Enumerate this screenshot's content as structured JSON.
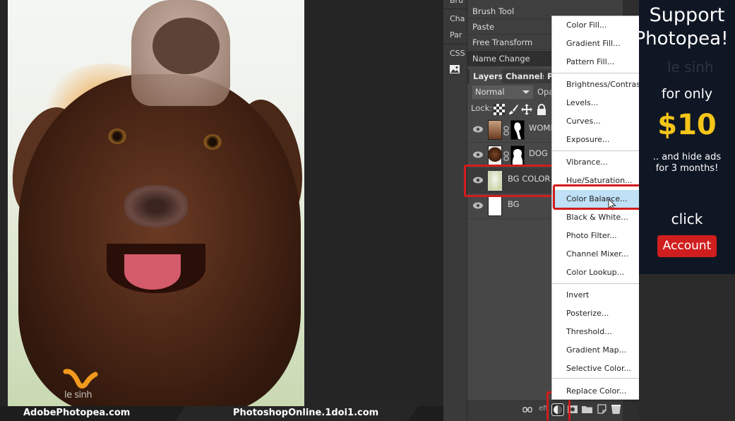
{
  "canvas": {
    "watermark": "le sinh",
    "banner_left": "AdobePhotopea.com",
    "banner_right": "PhotoshopOnline.1doi1.com"
  },
  "side_strip": {
    "items": [
      {
        "label": "Bru",
        "icon": "brush-panel"
      },
      {
        "label": "Cha",
        "icon": "character-panel"
      },
      {
        "label": "Par",
        "icon": "paragraph-panel"
      },
      {
        "label": "CSS",
        "icon": "css-panel"
      },
      {
        "label": "",
        "icon": "image-icon"
      }
    ]
  },
  "history": {
    "items": [
      "Brush Tool",
      "Paste",
      "Free Transform",
      "Name Change"
    ],
    "selected_index": 3
  },
  "layers_panel": {
    "tabs": [
      "Layers",
      "Channels",
      "P"
    ],
    "active_tab": "Layers",
    "blend_mode": "Normal",
    "opacity_label": "Opa",
    "lock_label": "Lock:",
    "layers": [
      {
        "name": "WOME",
        "visible": true,
        "has_mask": true
      },
      {
        "name": "DOG",
        "visible": true,
        "has_mask": true
      },
      {
        "name": "BG COLOR",
        "visible": true,
        "has_mask": false,
        "selected": true
      },
      {
        "name": "BG",
        "visible": true,
        "has_mask": false
      }
    ],
    "footer_icons": [
      "link-icon",
      "effects-icon",
      "adjustment-layer-icon",
      "mask-icon",
      "folder-icon",
      "new-layer-icon",
      "trash-icon"
    ],
    "effects_label": "eff"
  },
  "adjustment_menu": {
    "groups": [
      [
        "Color Fill...",
        "Gradient Fill...",
        "Pattern Fill..."
      ],
      [
        "Brightness/Contrast...",
        "Levels...",
        "Curves...",
        "Exposure..."
      ],
      [
        "Vibrance...",
        "Hue/Saturation...",
        "Color Balance...",
        "Black & White...",
        "Photo Filter...",
        "Channel Mixer...",
        "Color Lookup..."
      ],
      [
        "Invert",
        "Posterize...",
        "Threshold...",
        "Gradient Map...",
        "Selective Color..."
      ],
      [
        "Replace Color..."
      ]
    ],
    "hovered": "Color Balance..."
  },
  "ad": {
    "line1": "Support",
    "line2": "Photopea!",
    "line3": "for only",
    "price": "$10",
    "line4": ".. and hide ads",
    "line5": "for 3 months!",
    "click": "click",
    "button": "Account",
    "watermark": "le sinh"
  },
  "colors": {
    "highlight": "#d31c1c",
    "menu_hover": "#bfe0f6",
    "ad_price": "#f5c518",
    "ad_button": "#d01e1e"
  }
}
